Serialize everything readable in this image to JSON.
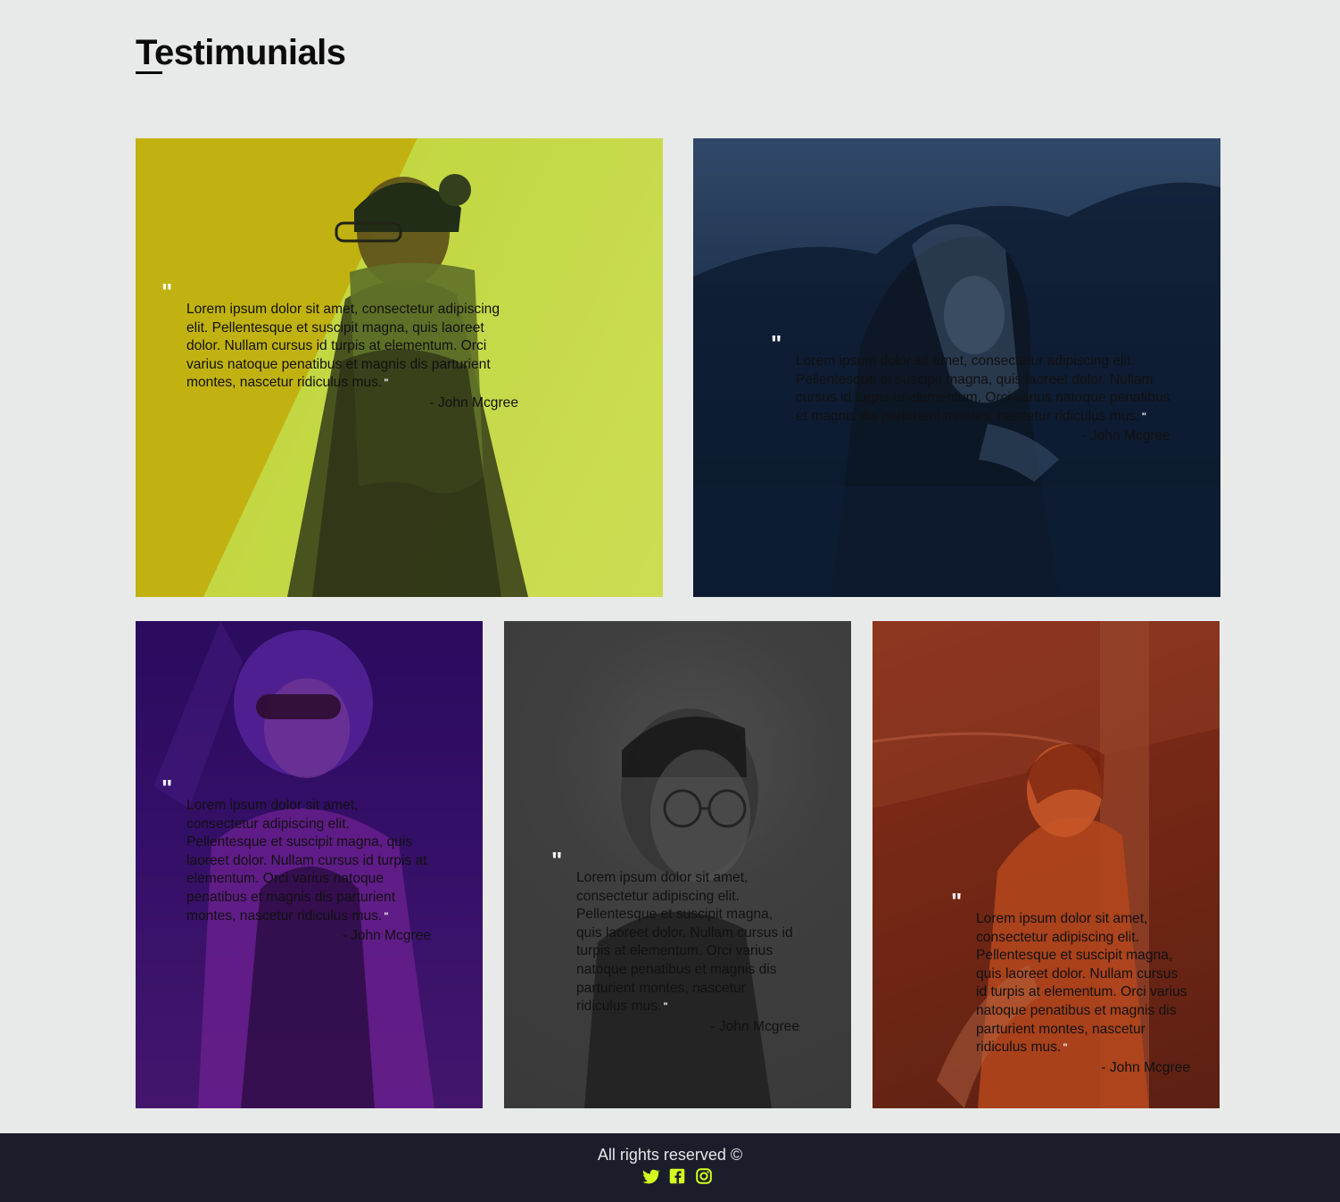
{
  "page": {
    "title": "Testimunials"
  },
  "cards": [
    {
      "quote_mark": "\"",
      "text": "Lorem ipsum dolor sit amet, consectetur adipiscing elit. Pellentesque et suscipit magna, quis laoreet dolor. Nullam cursus id turpis at elementum. Orci varius natoque penatibus et magnis dis parturient montes, nascetur ridiculus mus.",
      "close_mark": "\"",
      "author": "- John Mcgree",
      "overlay_color": "#dce86e"
    },
    {
      "quote_mark": "\"",
      "text": "Lorem ipsum dolor sit amet, consectetur adipiscing elit. Pellentesque et suscipit magna, quis laoreet dolor. Nullam cursus id turpis at elementum. Orci varius natoque penatibus et magnis dis parturient montes, nascetur ridiculus mus.",
      "close_mark": "\"",
      "author": "- John Mcgree",
      "overlay_color": "#4f6b8a"
    },
    {
      "quote_mark": "\"",
      "text": "Lorem ipsum dolor sit amet, consectetur adipiscing elit. Pellentesque et suscipit magna, quis laoreet dolor. Nullam cursus id turpis at elementum. Orci varius natoque penatibus et magnis dis parturient montes, nascetur ridiculus mus.",
      "close_mark": "\"",
      "author": "- John Mcgree",
      "overlay_color": "#6f2f9c"
    },
    {
      "quote_mark": "\"",
      "text": "Lorem ipsum dolor sit amet, consectetur adipiscing elit. Pellentesque et suscipit magna, quis laoreet dolor. Nullam cursus id turpis at elementum. Orci varius natoque penatibus et magnis dis parturient montes, nascetur ridiculus mus.",
      "close_mark": "\"",
      "author": "- John Mcgree",
      "overlay_color": "#737373"
    },
    {
      "quote_mark": "\"",
      "text": "Lorem ipsum dolor sit amet, consectetur adipiscing elit. Pellentesque et suscipit magna, quis laoreet dolor. Nullam cursus id turpis at elementum. Orci varius natoque penatibus et magnis dis parturient montes, nascetur ridiculus mus.",
      "close_mark": "\"",
      "author": "- John Mcgree",
      "overlay_color": "#c8673f"
    }
  ],
  "footer": {
    "text": "All rights reserved ©",
    "icon_color": "#d4ff1e",
    "icons": [
      "twitter-icon",
      "facebook-icon",
      "instagram-icon"
    ]
  }
}
